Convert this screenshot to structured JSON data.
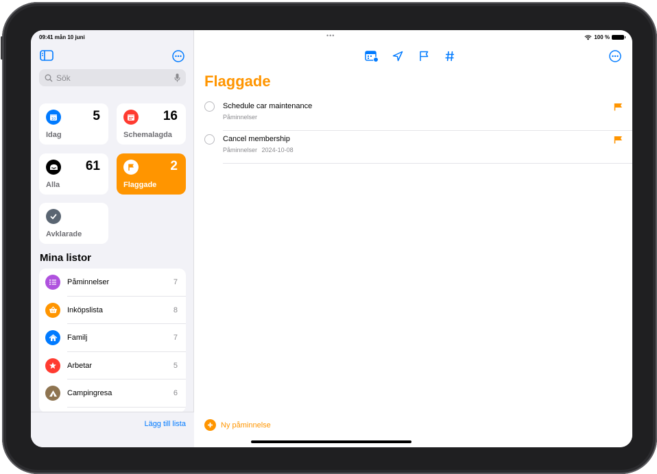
{
  "status": {
    "time_date": "09:41  mån 10 juni",
    "battery": "100 %"
  },
  "sidebar": {
    "search_placeholder": "Sök",
    "smart_lists": [
      {
        "label": "Idag",
        "count": "5",
        "color": "#007aff"
      },
      {
        "label": "Schemalagda",
        "count": "16",
        "color": "#ff3b30"
      },
      {
        "label": "Alla",
        "count": "61",
        "color": "#000000"
      },
      {
        "label": "Flaggade",
        "count": "2",
        "color": "#ff9500"
      },
      {
        "label": "Avklarade",
        "count": "",
        "color": "#5a6572"
      }
    ],
    "my_lists_title": "Mina listor",
    "lists": [
      {
        "name": "Påminnelser",
        "count": "7",
        "color": "#af52de",
        "icon": "list-bullet-icon"
      },
      {
        "name": "Inköpslista",
        "count": "8",
        "color": "#ff9500",
        "icon": "basket-icon"
      },
      {
        "name": "Familj",
        "count": "7",
        "color": "#007aff",
        "icon": "house-icon"
      },
      {
        "name": "Arbetar",
        "count": "5",
        "color": "#ff3b30",
        "icon": "star-icon"
      },
      {
        "name": "Campingresa",
        "count": "6",
        "color": "#8e7450",
        "icon": "tent-icon"
      }
    ],
    "add_list": "Lägg till lista"
  },
  "main": {
    "title": "Flaggade",
    "reminders": [
      {
        "title": "Schedule car maintenance",
        "list": "Påminnelser",
        "date": ""
      },
      {
        "title": "Cancel membership",
        "list": "Påminnelser",
        "date": "2024-10-08"
      }
    ],
    "new_reminder": "Ny påminnelse"
  },
  "colors": {
    "accent": "#ff9500",
    "link": "#007aff"
  }
}
